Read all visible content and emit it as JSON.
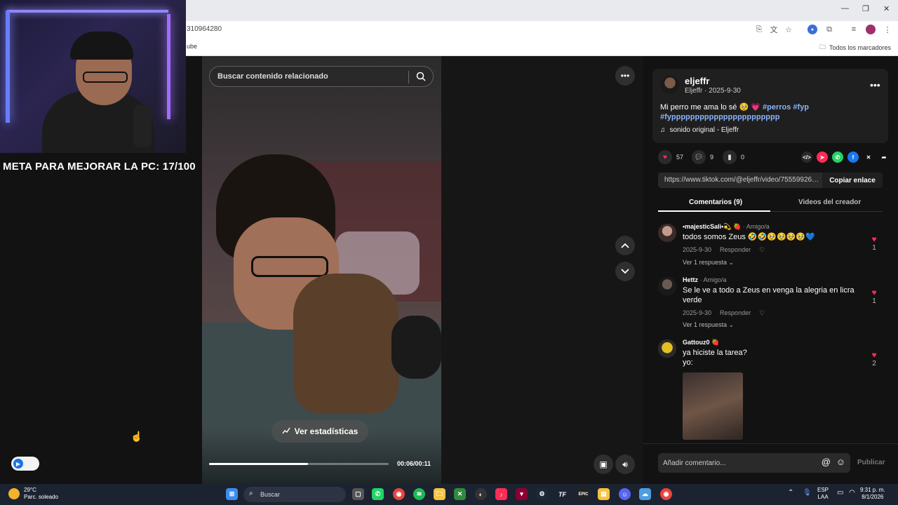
{
  "browser": {
    "url_fragment": "310964280",
    "bookmark_left": "ube",
    "bookmark_right": "Todos los marcadores",
    "win_min": "—",
    "win_max": "❐",
    "win_close": "✕"
  },
  "stream_overlay": {
    "goal_text": "META PARA MEJORAR LA PC: 17/100"
  },
  "video": {
    "search_placeholder": "Buscar contenido relacionado",
    "stats_label": "Ver estadísticas",
    "time": "00:06/00:11",
    "progress_fraction": 0.55
  },
  "post": {
    "author": "eljeffr",
    "author_sub": "Eljeffr · 2025-9-30",
    "description_text": "Mi perro me ama lo sé 🥹 💗",
    "tags_line1": "#perros #fyp",
    "tags_line2": "#fyppppppppppppppppppppppp",
    "music": "sonido original - Eljeffr",
    "likes": "57",
    "comments": "9",
    "saves": "0",
    "share_url": "https://www.tiktok.com/@eljeffr/video/755599265...",
    "copy_label": "Copiar enlace"
  },
  "tabs": {
    "comments": "Comentarios (9)",
    "creator_videos": "Videos del creador"
  },
  "comments": [
    {
      "name": "•majesticSali•💫 🍓",
      "friend": " · Amigo/a",
      "text": "todos somos Zeus 🤣🤣🥹🥹🥹🥹💙",
      "date": "2025-9-30",
      "reply": "Responder",
      "replies": "Ver 1 respuesta ⌄",
      "likes": "1"
    },
    {
      "name": "Hettz",
      "friend": " · Amigo/a",
      "text": "Se le ve a todo a Zeus en venga la alegria en licra verde",
      "date": "2025-9-30",
      "reply": "Responder",
      "replies": "Ver 1 respuesta ⌄",
      "likes": "1"
    },
    {
      "name": "Gattouz0 🍓",
      "friend": "",
      "text_line1": "ya hiciste la tarea?",
      "text_line2": "yo:",
      "likes": "2"
    }
  ],
  "comment_bar": {
    "placeholder": "Añadir comentario...",
    "publish": "Publicar"
  },
  "taskbar": {
    "temp": "29°C",
    "weather": "Parc. soleado",
    "search": "Buscar",
    "lang1": "ESP",
    "lang2": "LAA",
    "time": "9:31 p. m.",
    "date": "8/1/2026"
  },
  "colors": {
    "accent_red": "#fe2c55",
    "tag_blue": "#8ab4f8",
    "panel_bg": "#121212"
  }
}
